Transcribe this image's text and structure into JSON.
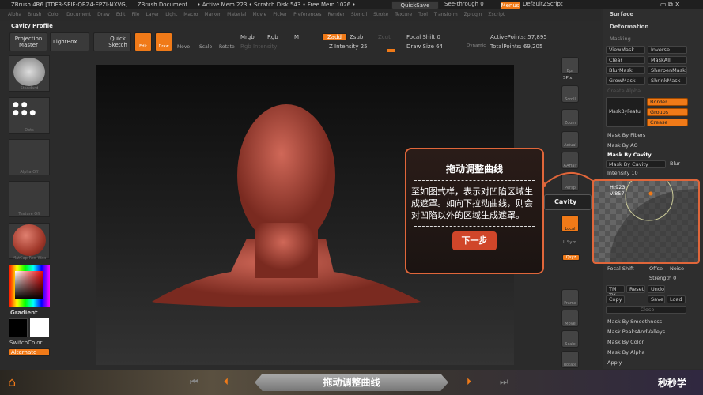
{
  "titlebar": {
    "app": "ZBrush 4R6 [TDF3-SEIF-QBZ4-EPZI-NXVG]",
    "doc": "ZBrush Document",
    "mem": "• Active Mem 223 • Scratch Disk 543 • Free Mem 1026 •",
    "quicksave": "QuickSave",
    "seethrough": "See-through 0",
    "menus": "Menus",
    "script": "DefaultZScript"
  },
  "menu": [
    "Alpha",
    "Brush",
    "Color",
    "Document",
    "Draw",
    "Edit",
    "File",
    "Layer",
    "Light",
    "Macro",
    "Marker",
    "Material",
    "Movie",
    "Picker",
    "Preferences",
    "Render",
    "Stencil",
    "Stroke",
    "Texture",
    "Tool",
    "Transform",
    "Zplugin",
    "Zscript"
  ],
  "palette_title": "Cavity Profile",
  "toolbar": {
    "projection": "Projection Master",
    "lightbox": "LightBox",
    "quicksketch": "Quick Sketch",
    "edit": "Edit",
    "draw": "Draw",
    "move": "Move",
    "scale": "Scale",
    "rotate": "Rotate",
    "mrgb": "Mrgb",
    "rgb": "Rgb",
    "m": "M",
    "rgb_intensity": "Rgb Intensity",
    "zadd": "Zadd",
    "zsub": "Zsub",
    "zcut": "Zcut",
    "z_intensity": "Z Intensity 25",
    "focal_shift": "Focal Shift 0",
    "draw_size": "Draw Size 64",
    "dynamic": "Dynamic",
    "active_points": "ActivePoints: 57,895",
    "total_points": "TotalPoints: 69,205"
  },
  "shelf": {
    "brush": "Standard",
    "stroke": "Dots",
    "alpha": "Alpha Off",
    "texture": "Texture Off",
    "material": "MatCap Red Wax",
    "gradient": "Gradient",
    "switchcolor": "SwitchColor",
    "alternate": "Alternate"
  },
  "right_tools": [
    "Bpr",
    "SPix",
    "Scroll",
    "Zoom",
    "Actual",
    "AAHalf",
    "Persp",
    "Local",
    "L.Sym",
    "Qxyz",
    "Frame",
    "Move",
    "Scale",
    "Rotate"
  ],
  "callout_label": "Cavity Profile",
  "panel": {
    "surface": "Surface",
    "deformation": "Deformation",
    "masking": "Masking",
    "viewmask": "ViewMask",
    "inverse": "Inverse",
    "clear": "Clear",
    "maskall": "MaskAll",
    "blurmask": "BlurMask",
    "sharpenmask": "SharpenMask",
    "growmask": "GrowMask",
    "shrinkmask": "ShrinkMask",
    "createalpha": "Create Alpha",
    "maskbyfeature": "MaskByFeatu",
    "border": "Border",
    "groups": "Groups",
    "crease": "Crease",
    "fibers": "Mask By Fibers",
    "ao": "Mask By AO",
    "cavity_header": "Mask By Cavity",
    "cavity_btn": "Mask By Cavity",
    "blur": "Blur",
    "intensity": "Intensity 10",
    "curve_h": "H:923",
    "curve_v": "V:857",
    "focal": "Focal Shift",
    "offset": "Offse",
    "noise": "Noise",
    "strength": "Strength 0",
    "tm": "TM",
    "tv": "TV",
    "reset": "Reset",
    "undo": "Undo",
    "copy": "Copy",
    "save": "Save",
    "load": "Load",
    "close": "Close",
    "smoothness": "Mask By Smoothness",
    "peaks": "Mask PeaksAndValleys",
    "color": "Mask By Color",
    "alpha": "Mask By Alpha",
    "apply": "Apply"
  },
  "tip": {
    "title": "拖动调整曲线",
    "body": "至如图式样，表示对凹陷区域生成遮罩。如向下拉动曲线，则会对凹陷以外的区域生成遮罩。",
    "next": "下一步"
  },
  "bottom": {
    "title": "拖动调整曲线",
    "logo": "秒秒学"
  },
  "colors": {
    "accent": "#f07a18",
    "tip_border": "#e0663a"
  }
}
